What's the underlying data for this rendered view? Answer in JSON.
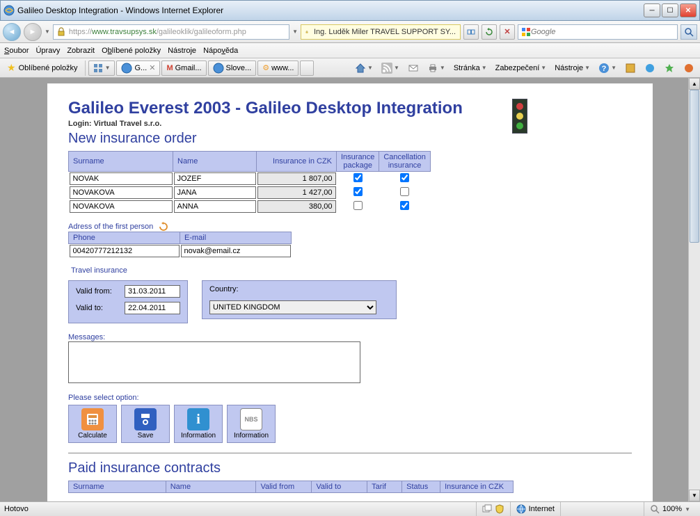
{
  "window": {
    "title": "Galileo Desktop Integration - Windows Internet Explorer"
  },
  "address": {
    "proto": "https://",
    "host": "www.travsupsys.sk",
    "path": "/galileoklik/galileoform.php",
    "identity": "Ing. Luděk Miler TRAVEL SUPPORT SY..."
  },
  "search": {
    "placeholder": "Google"
  },
  "menus": {
    "soubor": "Soubor",
    "upravy": "Úpravy",
    "zobrazit": "Zobrazit",
    "oblibene": "Oblíbené položky",
    "nastroje": "Nástroje",
    "napoveda": "Nápověda"
  },
  "favbar": {
    "favorites": "Oblíbené položky"
  },
  "tabs": [
    {
      "label": "G..."
    },
    {
      "label": "Gmail..."
    },
    {
      "label": "Slove..."
    },
    {
      "label": "www..."
    }
  ],
  "toolbar": {
    "stranka": "Stránka",
    "zabezpeceni": "Zabezpečení",
    "nastroje": "Nástroje"
  },
  "page": {
    "title": "Galileo Everest 2003 - Galileo Desktop Integration",
    "login": "Login: Virtual Travel s.r.o.",
    "section_new": "New insurance order",
    "headers": {
      "surname": "Surname",
      "name": "Name",
      "insurance_czk": "Insurance in CZK",
      "ins_pkg": "Insurance package",
      "cancel_ins": "Cancellation insurance"
    },
    "rows": [
      {
        "surname": "NOVAK",
        "name": "JOZEF",
        "czk": "1 807,00",
        "pkg": true,
        "cancel": true
      },
      {
        "surname": "NOVAKOVA",
        "name": "JANA",
        "czk": "1 427,00",
        "pkg": true,
        "cancel": false
      },
      {
        "surname": "NOVAKOVA",
        "name": "ANNA",
        "czk": "380,00",
        "pkg": false,
        "cancel": true
      }
    ],
    "adress_label": "Adress of the first person",
    "contact_headers": {
      "phone": "Phone",
      "email": "E-mail"
    },
    "contact": {
      "phone": "00420777212132",
      "email": "novak@email.cz"
    },
    "travel_ins_label": "Travel insurance",
    "valid_from_lbl": "Valid from:",
    "valid_from": "31.03.2011",
    "valid_to_lbl": "Valid to:",
    "valid_to": "22.04.2011",
    "country_lbl": "Country:",
    "country": "UNITED KINGDOM",
    "messages_lbl": "Messages:",
    "options_lbl": "Please select option:",
    "buttons": {
      "calculate": "Calculate",
      "save": "Save",
      "info1": "Information",
      "info2": "Information",
      "nbs": "NBS"
    },
    "section_paid": "Paid insurance contracts",
    "paid_headers": {
      "surname": "Surname",
      "name": "Name",
      "valid_from": "Valid from",
      "valid_to": "Valid to",
      "tarif": "Tarif",
      "status": "Status",
      "ins_czk": "Insurance in CZK"
    }
  },
  "status": {
    "ready": "Hotovo",
    "zone": "Internet",
    "zoom": "100%"
  }
}
